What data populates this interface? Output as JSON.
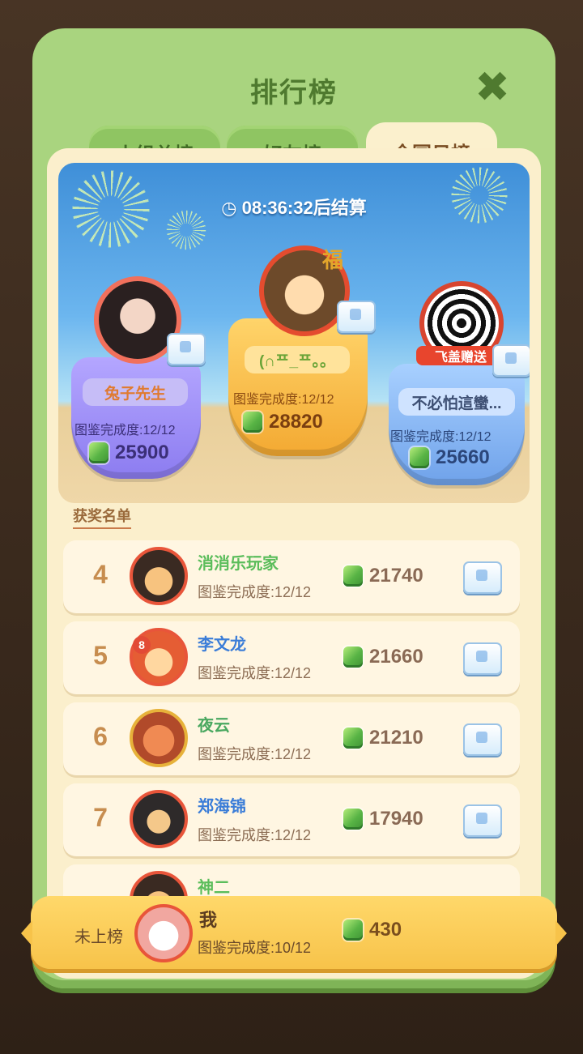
{
  "title": "排行榜",
  "tabs": [
    {
      "label": "小组总榜",
      "active": false
    },
    {
      "label": "好友榜",
      "active": false
    },
    {
      "label": "全国日榜",
      "active": true
    }
  ],
  "timer": "08:36:32后结算",
  "podium": {
    "first": {
      "name": "(∩ᄑ_ᄑ。。",
      "completion": "图鉴完成度:12/12",
      "score": "28820"
    },
    "second": {
      "name": "兔子先生",
      "completion": "图鉴完成度:12/12",
      "score": "25900"
    },
    "third": {
      "name": "不必怕這蠻...",
      "completion": "图鉴完成度:12/12",
      "score": "25660",
      "badge_text": "飞盖赠送"
    }
  },
  "award_list_label": "获奖名单",
  "rows": [
    {
      "rank": "4",
      "name": "消消乐玩家",
      "completion": "图鉴完成度:12/12",
      "score": "21740"
    },
    {
      "rank": "5",
      "name": "李文龙",
      "completion": "图鉴完成度:12/12",
      "score": "21660"
    },
    {
      "rank": "6",
      "name": "夜云",
      "completion": "图鉴完成度:12/12",
      "score": "21210"
    },
    {
      "rank": "7",
      "name": "郑海锦",
      "completion": "图鉴完成度:12/12",
      "score": "17940"
    },
    {
      "rank": "",
      "name": "神二",
      "completion": "",
      "score": ""
    }
  ],
  "me": {
    "rank_label": "未上榜",
    "name": "我",
    "completion": "图鉴完成度:10/12",
    "score": "430"
  },
  "avatar_badge": "8",
  "fu_char": "福",
  "close_icon": "✖",
  "colors": {
    "panel": "#a9d47f",
    "content": "#fbefcc",
    "gold": "#f7c34a",
    "purple": "#9a8bf0",
    "blue": "#7fb0f0"
  }
}
